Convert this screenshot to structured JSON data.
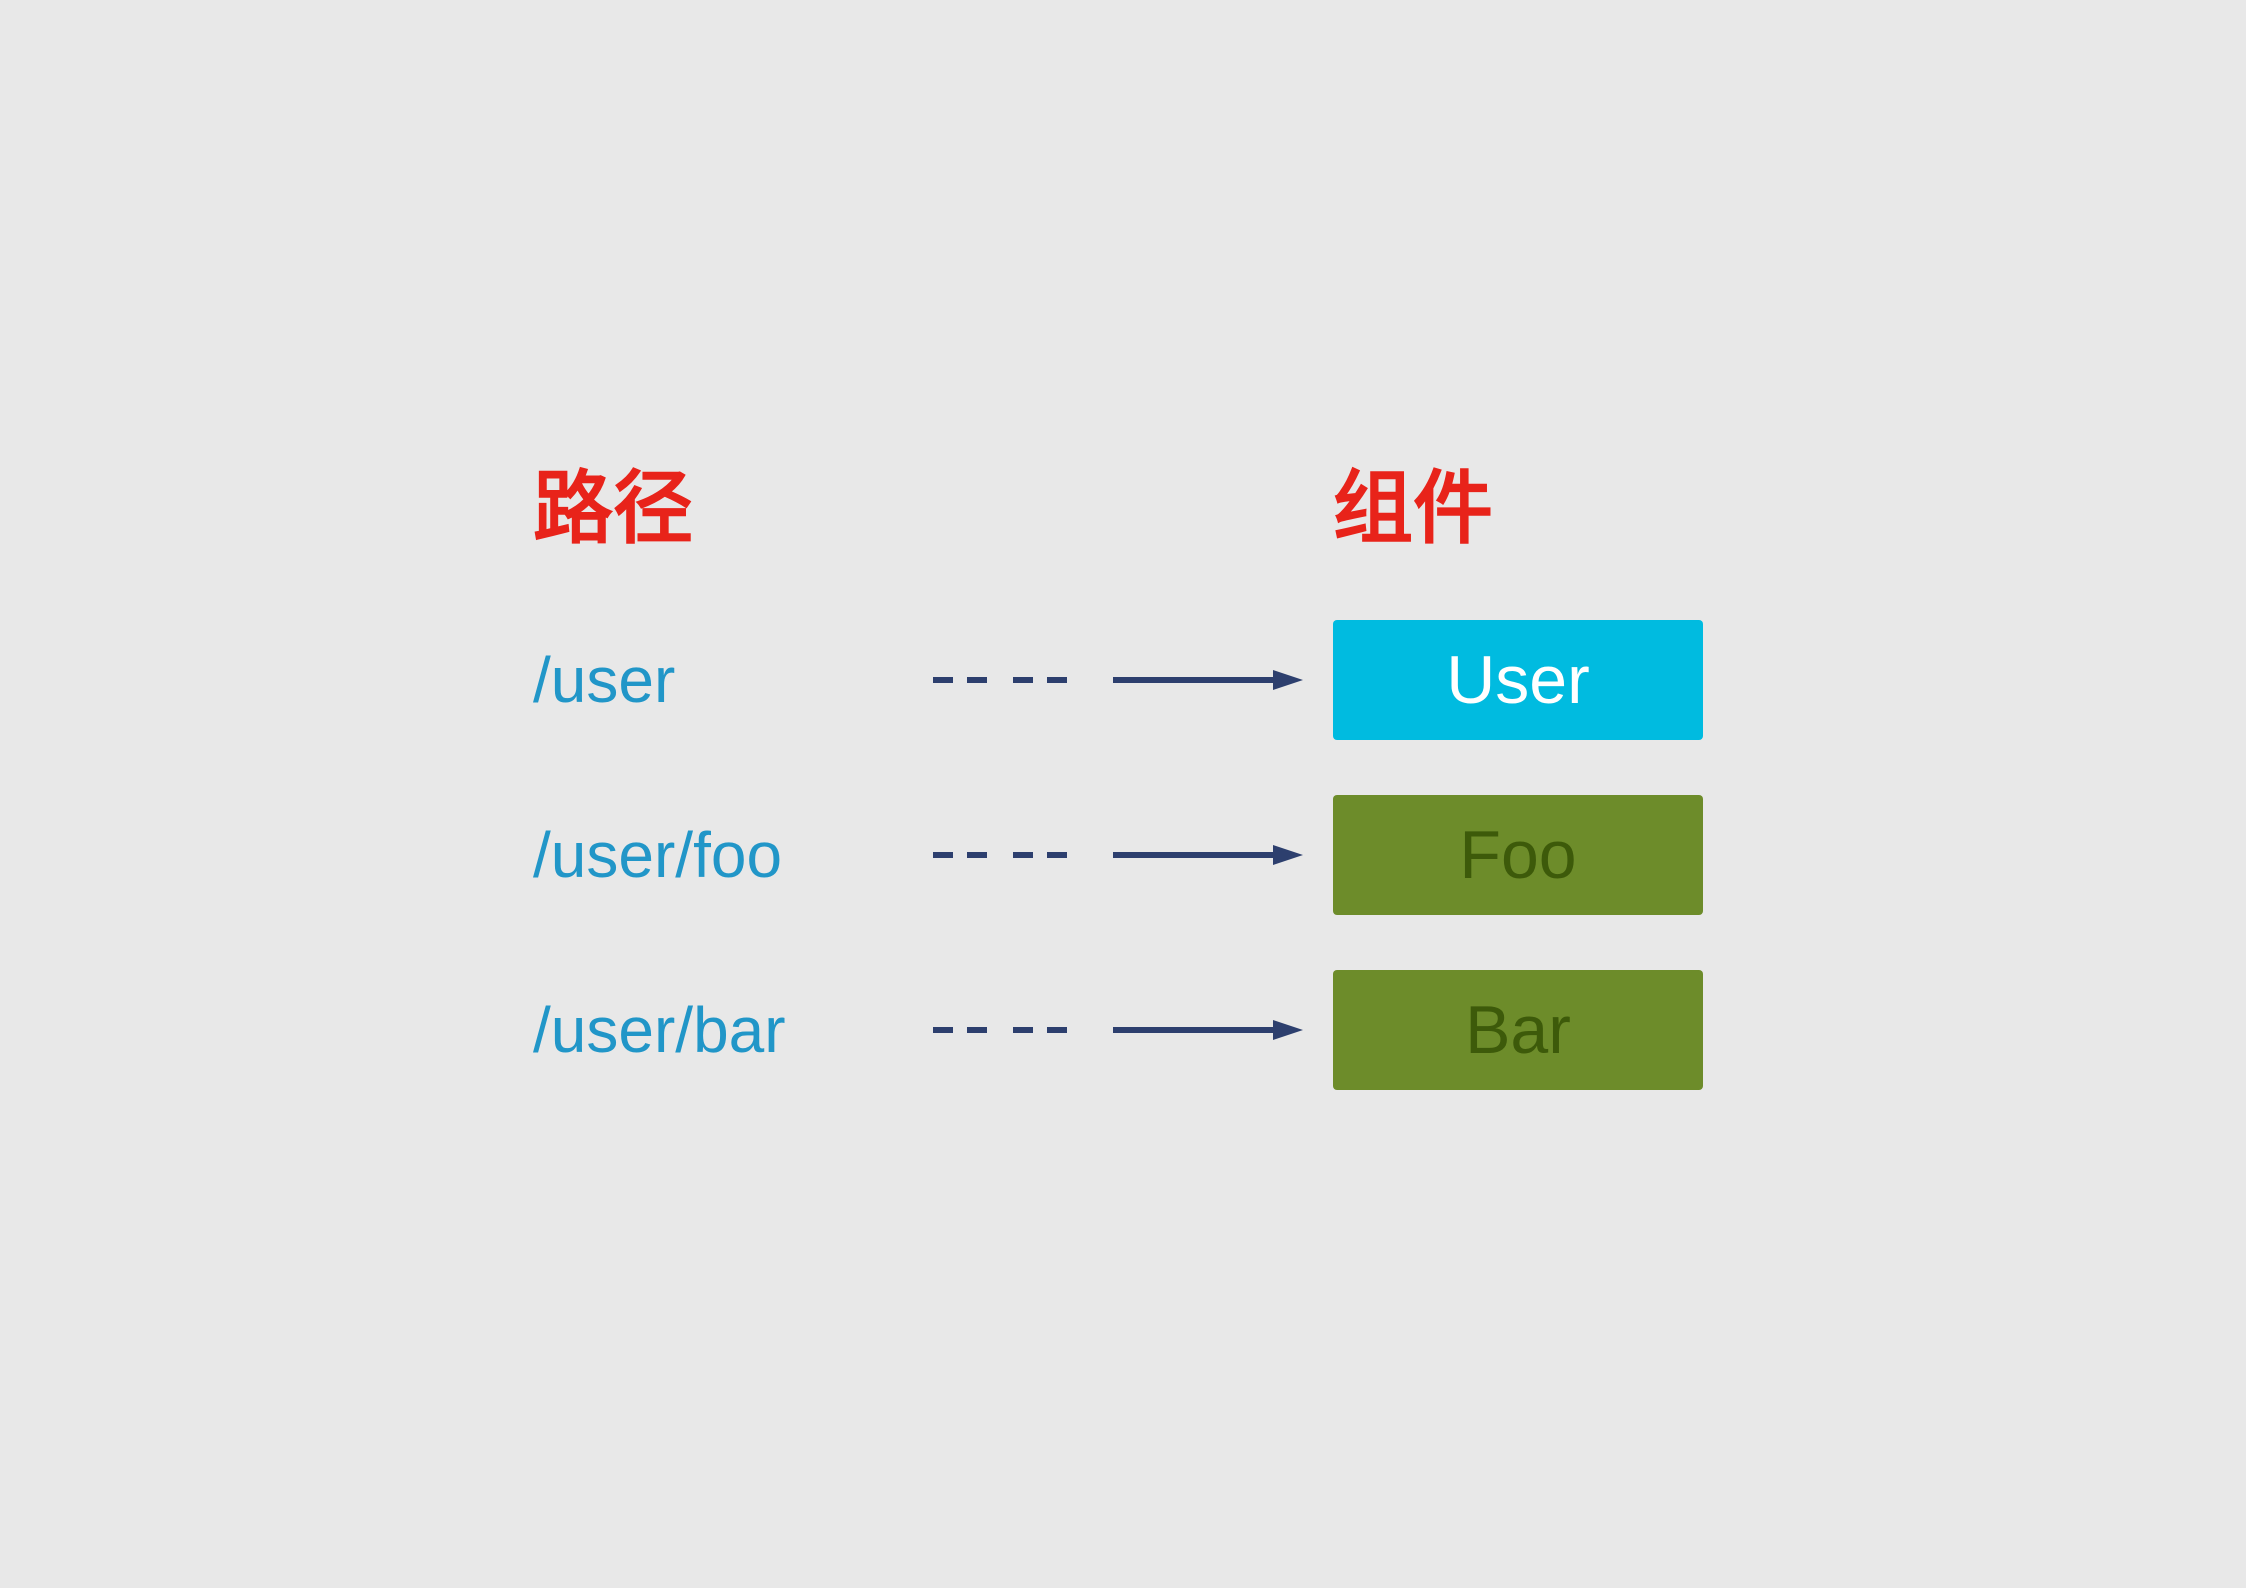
{
  "headers": {
    "path_label": "路径",
    "component_label": "组件"
  },
  "routes": [
    {
      "path": "/user",
      "component": "User",
      "component_style": "blue",
      "text_style": "white"
    },
    {
      "path": "/user/foo",
      "component": "Foo",
      "component_style": "green",
      "text_style": "green-text"
    },
    {
      "path": "/user/bar",
      "component": "Bar",
      "component_style": "green",
      "text_style": "green-text"
    }
  ],
  "colors": {
    "red": "#e8231a",
    "blue_text": "#2196c8",
    "component_blue": "#00bbe0",
    "component_green": "#6d8c2a",
    "arrow_color": "#2d3f6e"
  }
}
